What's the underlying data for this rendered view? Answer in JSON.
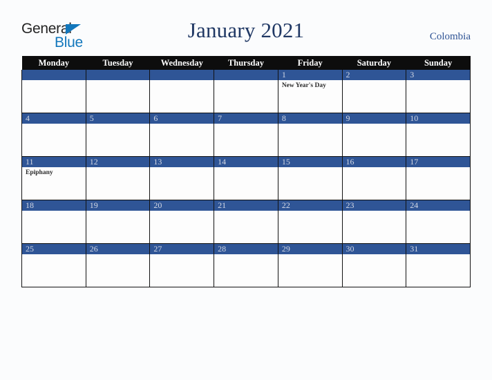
{
  "logo": {
    "word_top": "General",
    "word_bottom": "Blue",
    "triangle_color": "#1277bc",
    "text_color": "#242424"
  },
  "header": {
    "title": "January 2021",
    "country": "Colombia",
    "title_color": "#203864",
    "country_color": "#2e5394"
  },
  "calendar": {
    "weekday_headers": [
      "Monday",
      "Tuesday",
      "Wednesday",
      "Thursday",
      "Friday",
      "Saturday",
      "Sunday"
    ],
    "header_bg": "#0d0d0d",
    "daybar_bg": "#2f5596",
    "daynum_color": "#d3d8e4",
    "weeks": [
      [
        {
          "day": "",
          "event": ""
        },
        {
          "day": "",
          "event": ""
        },
        {
          "day": "",
          "event": ""
        },
        {
          "day": "",
          "event": ""
        },
        {
          "day": "1",
          "event": "New Year's Day"
        },
        {
          "day": "2",
          "event": ""
        },
        {
          "day": "3",
          "event": ""
        }
      ],
      [
        {
          "day": "4",
          "event": ""
        },
        {
          "day": "5",
          "event": ""
        },
        {
          "day": "6",
          "event": ""
        },
        {
          "day": "7",
          "event": ""
        },
        {
          "day": "8",
          "event": ""
        },
        {
          "day": "9",
          "event": ""
        },
        {
          "day": "10",
          "event": ""
        }
      ],
      [
        {
          "day": "11",
          "event": "Epiphany"
        },
        {
          "day": "12",
          "event": ""
        },
        {
          "day": "13",
          "event": ""
        },
        {
          "day": "14",
          "event": ""
        },
        {
          "day": "15",
          "event": ""
        },
        {
          "day": "16",
          "event": ""
        },
        {
          "day": "17",
          "event": ""
        }
      ],
      [
        {
          "day": "18",
          "event": ""
        },
        {
          "day": "19",
          "event": ""
        },
        {
          "day": "20",
          "event": ""
        },
        {
          "day": "21",
          "event": ""
        },
        {
          "day": "22",
          "event": ""
        },
        {
          "day": "23",
          "event": ""
        },
        {
          "day": "24",
          "event": ""
        }
      ],
      [
        {
          "day": "25",
          "event": ""
        },
        {
          "day": "26",
          "event": ""
        },
        {
          "day": "27",
          "event": ""
        },
        {
          "day": "28",
          "event": ""
        },
        {
          "day": "29",
          "event": ""
        },
        {
          "day": "30",
          "event": ""
        },
        {
          "day": "31",
          "event": ""
        }
      ]
    ]
  }
}
